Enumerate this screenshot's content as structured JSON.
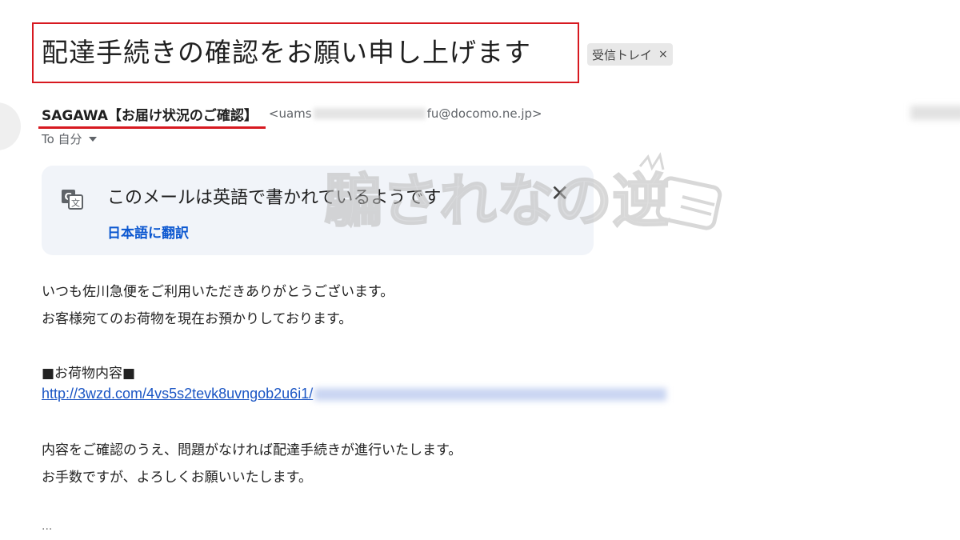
{
  "email": {
    "subject": "配達手続きの確認をお願い申し上げます",
    "label_chip": "受信トレイ",
    "label_chip_close": "×",
    "sender_name": "SAGAWA【お届け状況のご確認】",
    "sender_email_start": "<uams",
    "sender_email_end": "fu@docomo.ne.jp>",
    "to_line": "To 自分"
  },
  "translate_banner": {
    "message": "このメールは英語で書かれているようです",
    "close": "✕",
    "action": "日本語に翻訳"
  },
  "body": {
    "line1": "いつも佐川急便をご利用いただきありがとうございます。",
    "line2": "お客様宛てのお荷物を現在お預かりしております。",
    "heading": "■お荷物内容■",
    "link": "http://3wzd.com/4vs5s2tevk8uvngob2u6i1/",
    "line3": "内容をご確認のうえ、問題がなければ配達手続きが進行いたします。",
    "line4": "お手数ですが、よろしくお願いいたします。",
    "ellipsis": "..."
  },
  "watermark": {
    "text": "騙されなの逆"
  },
  "colors": {
    "highlight": "#d71920",
    "link": "#1a55c4",
    "card": "#f1f4f9"
  }
}
